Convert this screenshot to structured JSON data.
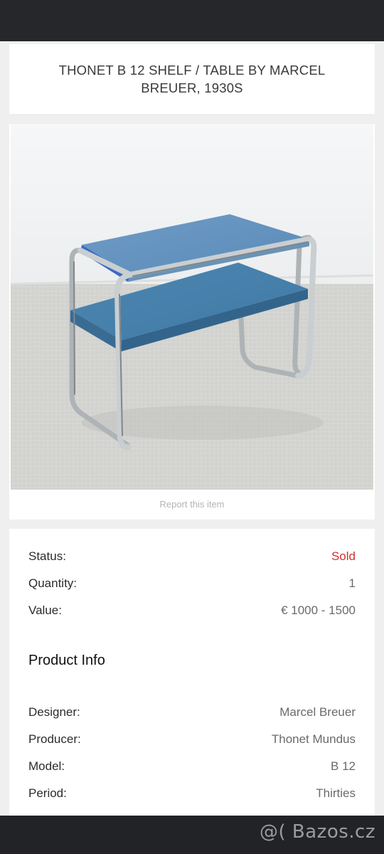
{
  "listing": {
    "title": "THONET B 12 SHELF / TABLE BY MARCEL BREUER, 1930S",
    "report_link": "Report this item"
  },
  "status_rows": [
    {
      "label": "Status:",
      "value": "Sold"
    },
    {
      "label": "Quantity:",
      "value": "1"
    },
    {
      "label": "Value:",
      "value": "€ 1000 - 1500"
    }
  ],
  "product_info": {
    "heading": "Product Info",
    "rows": [
      {
        "label": "Designer:",
        "value": "Marcel Breuer"
      },
      {
        "label": "Producer:",
        "value": "Thonet Mundus"
      },
      {
        "label": "Model:",
        "value": "B 12"
      },
      {
        "label": "Period:",
        "value": "Thirties"
      }
    ]
  },
  "colors": {
    "sold": "#d0312d",
    "card": "#ffffff",
    "background": "#efefef",
    "bars": "#26272b"
  },
  "watermark": "@( Bazos.cz"
}
